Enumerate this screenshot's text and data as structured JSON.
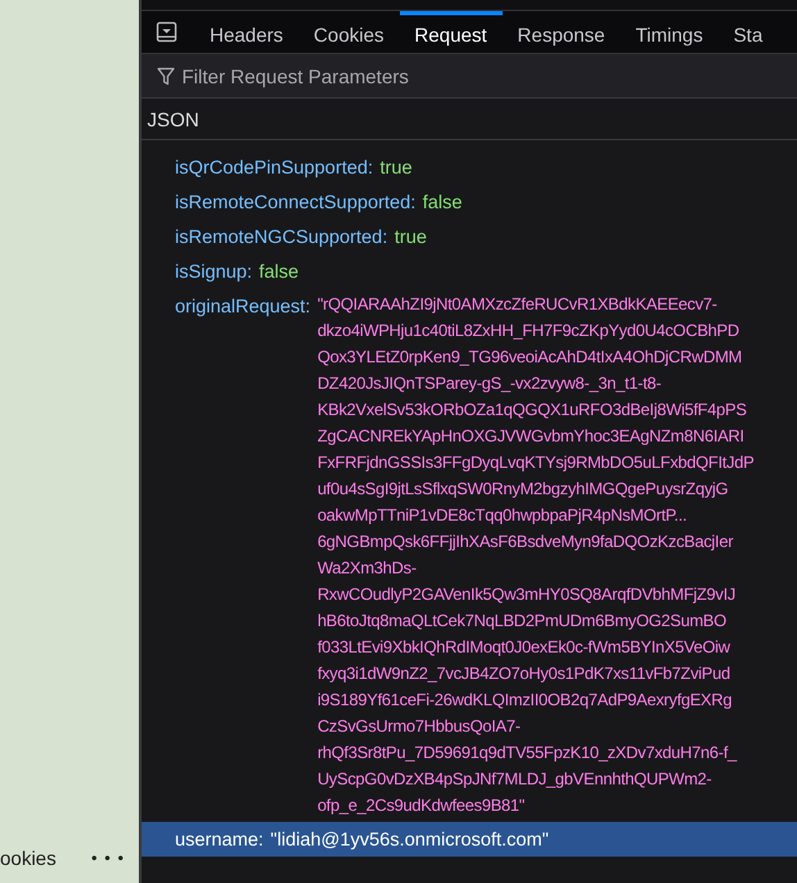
{
  "side_panel": {
    "label": "ookies",
    "more": "• • •"
  },
  "tabs": [
    {
      "label": "Headers",
      "selected": false
    },
    {
      "label": "Cookies",
      "selected": false
    },
    {
      "label": "Request",
      "selected": true
    },
    {
      "label": "Response",
      "selected": false
    },
    {
      "label": "Timings",
      "selected": false
    },
    {
      "label": "Sta",
      "selected": false
    }
  ],
  "filter": {
    "placeholder": "Filter Request Parameters"
  },
  "section": {
    "title": "JSON"
  },
  "params": [
    {
      "key": "isQrCodePinSupported:",
      "kind": "bool",
      "selected": false,
      "value_lines": [
        "true"
      ]
    },
    {
      "key": "isRemoteConnectSupported:",
      "kind": "bool",
      "selected": false,
      "value_lines": [
        "false"
      ]
    },
    {
      "key": "isRemoteNGCSupported:",
      "kind": "bool",
      "selected": false,
      "value_lines": [
        "true"
      ]
    },
    {
      "key": "isSignup:",
      "kind": "bool",
      "selected": false,
      "value_lines": [
        "false"
      ]
    },
    {
      "key": "originalRequest:",
      "kind": "string",
      "selected": false,
      "value_lines": [
        "\"rQQIARAAhZI9jNt0AMXzcZfeRUCvR1XBdkKAEEecv7-",
        "dkzo4iWPHju1c40tiL8ZxHH_FH7F9cZKpYyd0U4cOCBhPD",
        "Qox3YLEtZ0rpKen9_TG96veoiAcAhD4tIxA4OhDjCRwDMM",
        "DZ420JsJIQnTSParey-gS_-vx2zvyw8-_3n_t1-t8-",
        "KBk2VxelSv53kORbOZa1qQGQX1uRFO3dBeIj8Wi5fF4pPS",
        "ZgCACNREkYApHnOXGJVWGvbmYhoc3EAgNZm8N6IARI",
        "FxFRFjdnGSSIs3FFgDyqLvqKTYsj9RMbDO5uLFxbdQFItJdP",
        "uf0u4sSgI9jtLsSflxqSW0RnyM2bgzyhIMGQgePuysrZqyjG",
        "oakwMpTTniP1vDE8cTqq0hwpbpaPjR4pNsMOrtP...",
        "6gNGBmpQsk6FFjjIhXAsF6BsdveMyn9faDQOzKzcBacjIer",
        "Wa2Xm3hDs-",
        "RxwCOudlyP2GAVenIk5Qw3mHY0SQ8ArqfDVbhMFjZ9vIJ",
        "hB6toJtq8maQLtCek7NqLBD2PmUDm6BmyOG2SumBO",
        "f033LtEvi9XbkIQhRdIMoqt0J0exEk0c-fWm5BYInX5VeOiw",
        "fxyq3i1dW9nZ2_7vcJB4ZO7oHy0s1PdK7xs11vFb7ZviPud",
        "i9S189Yf61ceFi-26wdKLQImzII0OB2q7AdP9AexryfgEXRg",
        "CzSvGsUrmo7HbbusQoIA7-",
        "rhQf3Sr8tPu_7D59691q9dTV55FpzK10_zXDv7xduH7n6-f_",
        "UyScpG0vDzXB4pSpJNf7MLDJ_gbVEnnhthQUPWm2-",
        "ofp_e_2Cs9udKdwfees9B81\""
      ]
    },
    {
      "key": "username:",
      "kind": "string",
      "selected": true,
      "value_lines": [
        "\"lidiah@1yv56s.onmicrosoft.com\""
      ]
    }
  ]
}
